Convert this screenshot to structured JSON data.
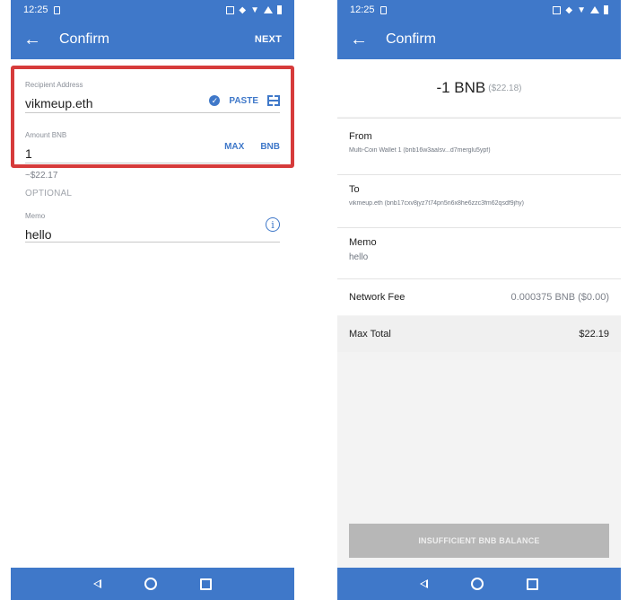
{
  "status": {
    "time": "12:25"
  },
  "left": {
    "appbar": {
      "title": "Confirm",
      "next_label": "NEXT"
    },
    "recipient": {
      "label": "Recipient Address",
      "value": "vikmeup.eth",
      "paste_label": "PASTE"
    },
    "amount": {
      "label": "Amount BNB",
      "value": "1",
      "max_label": "MAX",
      "currency_label": "BNB",
      "usd_estimate": "~$22.17"
    },
    "optional_label": "OPTIONAL",
    "memo": {
      "label": "Memo",
      "value": "hello"
    }
  },
  "right": {
    "appbar": {
      "title": "Confirm"
    },
    "amount_main": "-1 BNB",
    "amount_usd": "($22.18)",
    "from": {
      "label": "From",
      "value": "Multi-Coin Wallet 1 (bnb16w3aalsv...d7merglu5ypf)"
    },
    "to": {
      "label": "To",
      "value": "vikmeup.eth (bnb17cxv8jyz7t74pn5n6x8he6zzc3fm62qsdf9jhy)"
    },
    "memo": {
      "label": "Memo",
      "value": "hello"
    },
    "network_fee": {
      "label": "Network Fee",
      "value": "0.000375 BNB ($0.00)"
    },
    "max_total": {
      "label": "Max Total",
      "value": "$22.19"
    },
    "button_label": "INSUFFICIENT BNB BALANCE"
  },
  "colors": {
    "primary": "#3f78c9",
    "highlight": "#d63b3b",
    "disabled": "#b7b7b7"
  }
}
